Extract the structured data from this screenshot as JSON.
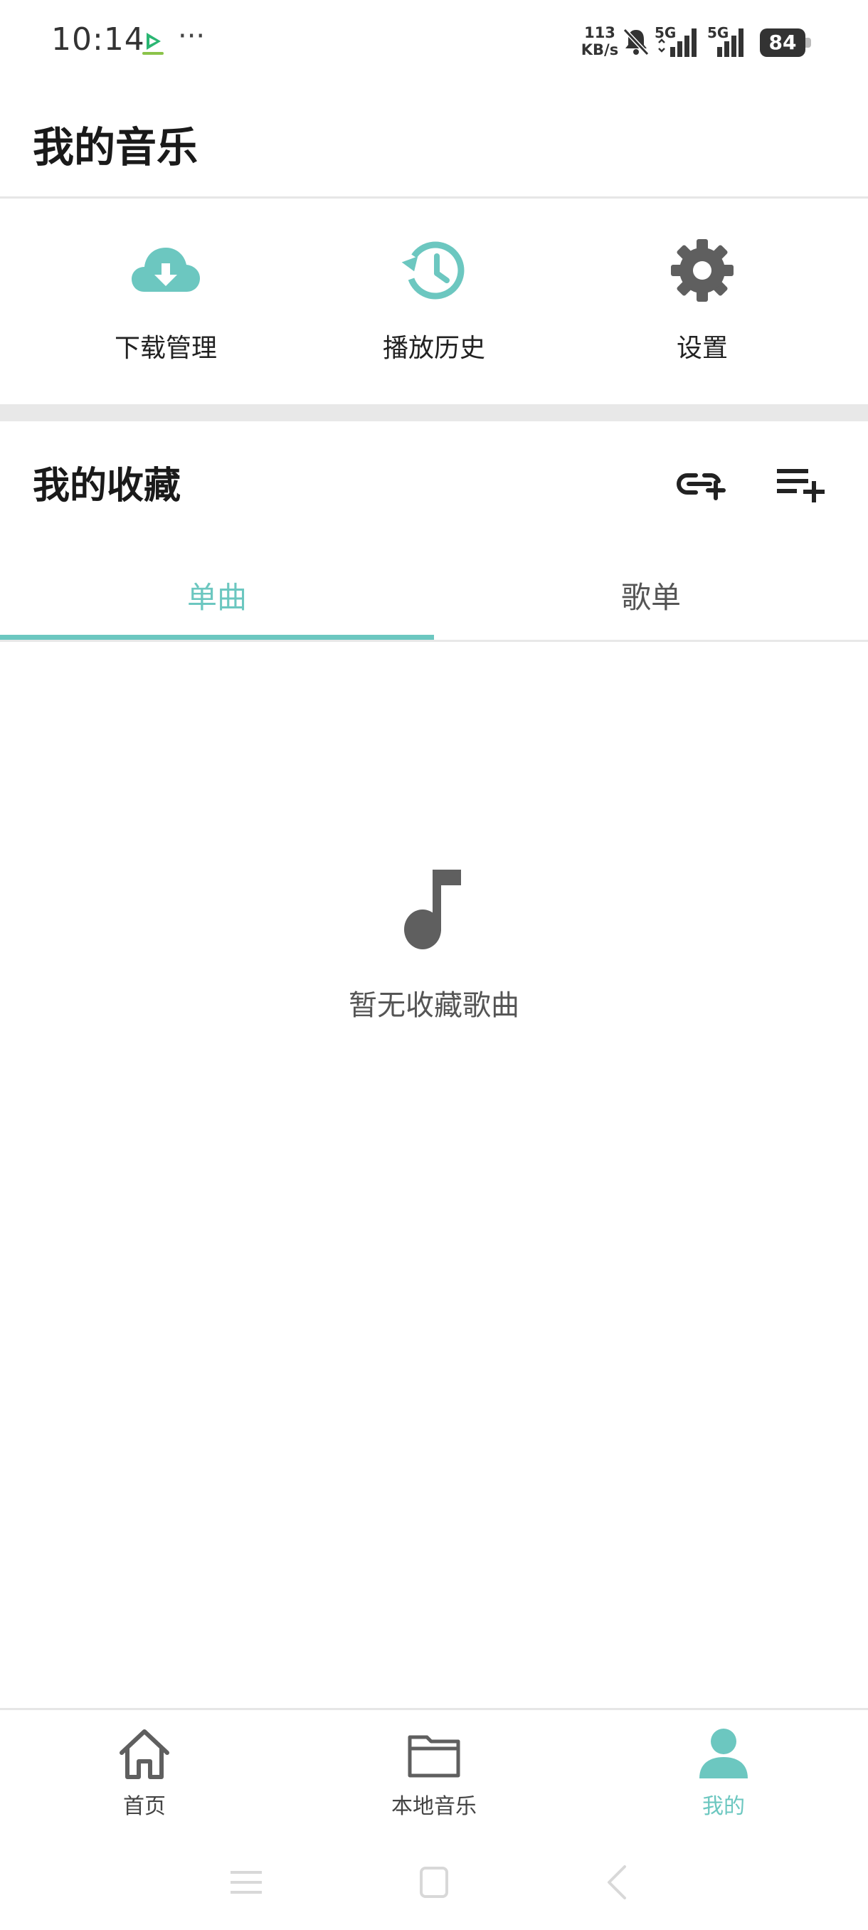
{
  "status_bar": {
    "time": "10:14",
    "more": "···",
    "net_speed_value": "113",
    "net_speed_unit": "KB/s",
    "signal1_label": "5G",
    "signal2_label": "5G",
    "battery": "84"
  },
  "header": {
    "title": "我的音乐"
  },
  "quick_actions": [
    {
      "label": "下载管理",
      "icon": "cloud-download-icon"
    },
    {
      "label": "播放历史",
      "icon": "history-icon"
    },
    {
      "label": "设置",
      "icon": "gear-icon"
    }
  ],
  "favorites": {
    "title": "我的收藏",
    "tabs": [
      {
        "label": "单曲",
        "active": true
      },
      {
        "label": "歌单",
        "active": false
      }
    ],
    "empty_text": "暂无收藏歌曲"
  },
  "bottom_nav": [
    {
      "label": "首页",
      "icon": "home-icon",
      "active": false
    },
    {
      "label": "本地音乐",
      "icon": "folder-icon",
      "active": false
    },
    {
      "label": "我的",
      "icon": "person-icon",
      "active": true
    }
  ],
  "colors": {
    "accent": "#6cc7c0",
    "icon_dark": "#666666",
    "text_primary": "#1a1a1a",
    "text_secondary": "#555555"
  }
}
